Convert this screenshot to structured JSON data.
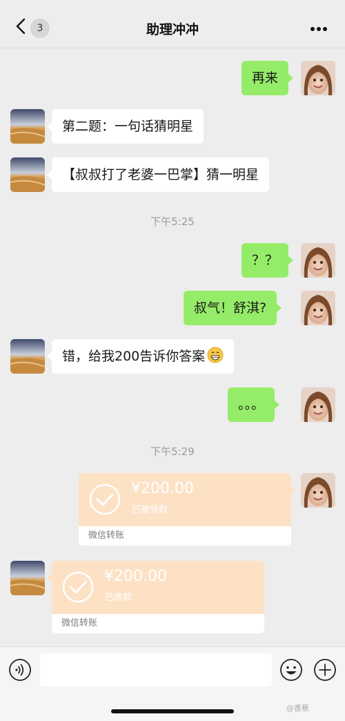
{
  "header": {
    "back_count": "3",
    "title": "助理冲冲"
  },
  "messages": {
    "m1": "再来",
    "m2": "第二题：一句话猜明星",
    "m3": "【叔叔打了老婆一巴掌】猜一明星",
    "t1": "下午5:25",
    "m4": "？？",
    "m5": "叔气！舒淇?",
    "m6": "错，给我200告诉你答案",
    "m7": "。。。",
    "t2": "下午5:29"
  },
  "transfers": {
    "sent": {
      "amount": "¥200.00",
      "status": "已被领取",
      "label": "微信转账"
    },
    "received": {
      "amount": "¥200.00",
      "status": "已收款",
      "label": "微信转账"
    }
  },
  "input": {
    "placeholder": ""
  },
  "watermark": "@香蕉",
  "colors": {
    "my_bubble": "#95ec69",
    "other_bubble": "#ffffff",
    "transfer_bg": "#fde1c5",
    "background": "#ededed"
  },
  "icons": {
    "back": "back-chevron-icon",
    "more": "more-dots-icon",
    "voice": "voice-icon",
    "emoji": "emoji-icon",
    "plus": "plus-icon",
    "check": "check-circle-icon"
  }
}
